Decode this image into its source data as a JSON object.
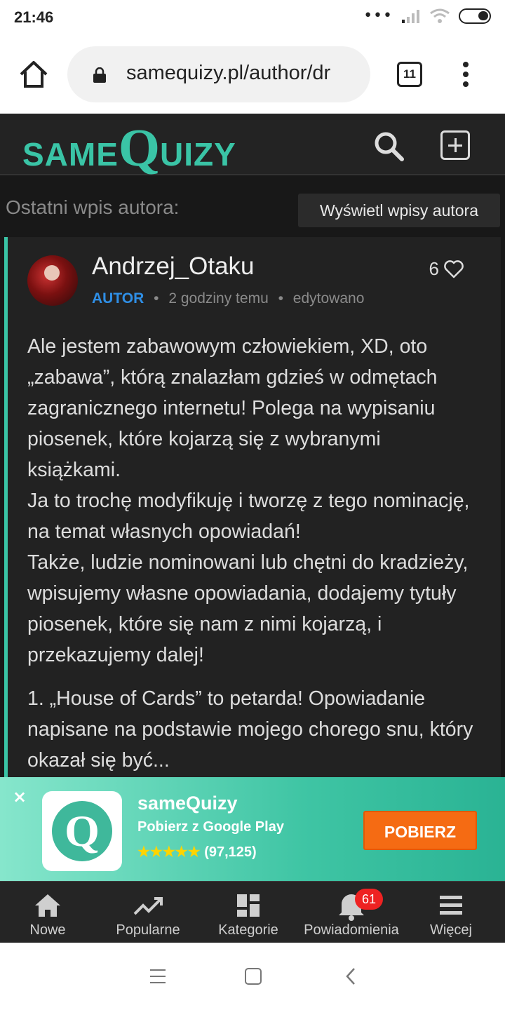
{
  "status_bar": {
    "time": "21:46",
    "dots": "•••"
  },
  "browser": {
    "url": "samequizy.pl/author/dr",
    "tab_count": "11"
  },
  "site": {
    "logo_same": "SAME",
    "logo_q": "Q",
    "logo_uizy": "UIZY"
  },
  "section": {
    "title": "Ostatni wpis autora:",
    "show_posts_button": "Wyświetl wpisy autora"
  },
  "post": {
    "author": "Andrzej_Otaku",
    "likes": "6",
    "role": "AUTOR",
    "time": "2 godziny temu",
    "edited": "edytowano",
    "separator": "•",
    "paragraph1": "Ale jestem zabawowym człowiekiem, XD, oto „zabawa”, którą znalazłam gdzieś w odmętach zagranicznego internetu! Polega na wypisaniu piosenek, które kojarzą się z wybranymi książkami.\nJa to trochę modyfikuję i tworzę z tego nominację, na temat własnych opowiadań!\nTakże, ludzie nominowani lub chętni do kradzieży, wpisujemy własne opowiadania, dodajemy tytuły piosenek, które się nam z nimi kojarzą, i przekazujemy dalej!",
    "paragraph2": "1. „House of Cards” to petarda! Opowiadanie napisane na podstawie mojego chorego snu, który okazał się być..."
  },
  "banner": {
    "close": "×",
    "icon_letter": "Q",
    "app_name": "sameQuizy",
    "subtitle": "Pobierz z Google Play",
    "stars": "★★★★★",
    "rating_count": "(97,125)",
    "button": "POBIERZ"
  },
  "bottom_nav": {
    "items": [
      {
        "label": "Nowe"
      },
      {
        "label": "Popularne"
      },
      {
        "label": "Kategorie"
      },
      {
        "label": "Powiadomienia",
        "badge": "61"
      },
      {
        "label": "Więcej"
      }
    ]
  },
  "colors": {
    "accent": "#3ac4a6",
    "role": "#2f8fe6",
    "download": "#f56b13",
    "badge": "#e22222",
    "background": "#181818"
  }
}
